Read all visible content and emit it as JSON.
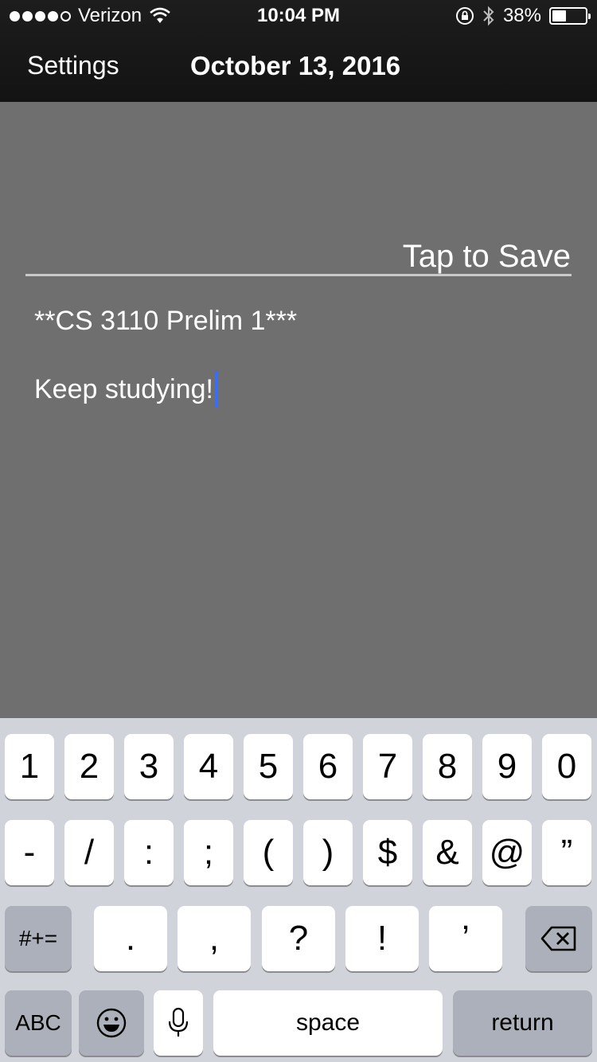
{
  "status_bar": {
    "carrier": "Verizon",
    "time": "10:04 PM",
    "battery": "38%",
    "battery_level": 0.38
  },
  "nav": {
    "left_button": "Settings",
    "title": "October 13, 2016"
  },
  "note": {
    "save_label": "Tap to Save",
    "line1": "**CS 3110 Prelim 1***",
    "editor_text": "Keep studying!"
  },
  "keyboard": {
    "row1": [
      "1",
      "2",
      "3",
      "4",
      "5",
      "6",
      "7",
      "8",
      "9",
      "0"
    ],
    "row2": [
      "-",
      "/",
      ":",
      ";",
      "(",
      ")",
      "$",
      "&",
      "@",
      "”"
    ],
    "row3": [
      ".",
      ",",
      "?",
      "!",
      "’"
    ],
    "symbols_label": "#+=",
    "abc_label": "ABC",
    "space_label": "space",
    "return_label": "return"
  },
  "icons": {
    "wifi": "wifi-icon",
    "rotation_lock": "rotation-lock-icon",
    "bluetooth": "bluetooth-icon",
    "battery": "battery-icon",
    "backspace": "backspace-icon",
    "emoji": "emoji-icon",
    "microphone": "microphone-icon"
  },
  "colors": {
    "nav_bg": "#1d1d1d",
    "note_bg": "#6f6f6f",
    "caret": "#3d6ef2",
    "keyboard_bg": "#d0d3d9"
  }
}
